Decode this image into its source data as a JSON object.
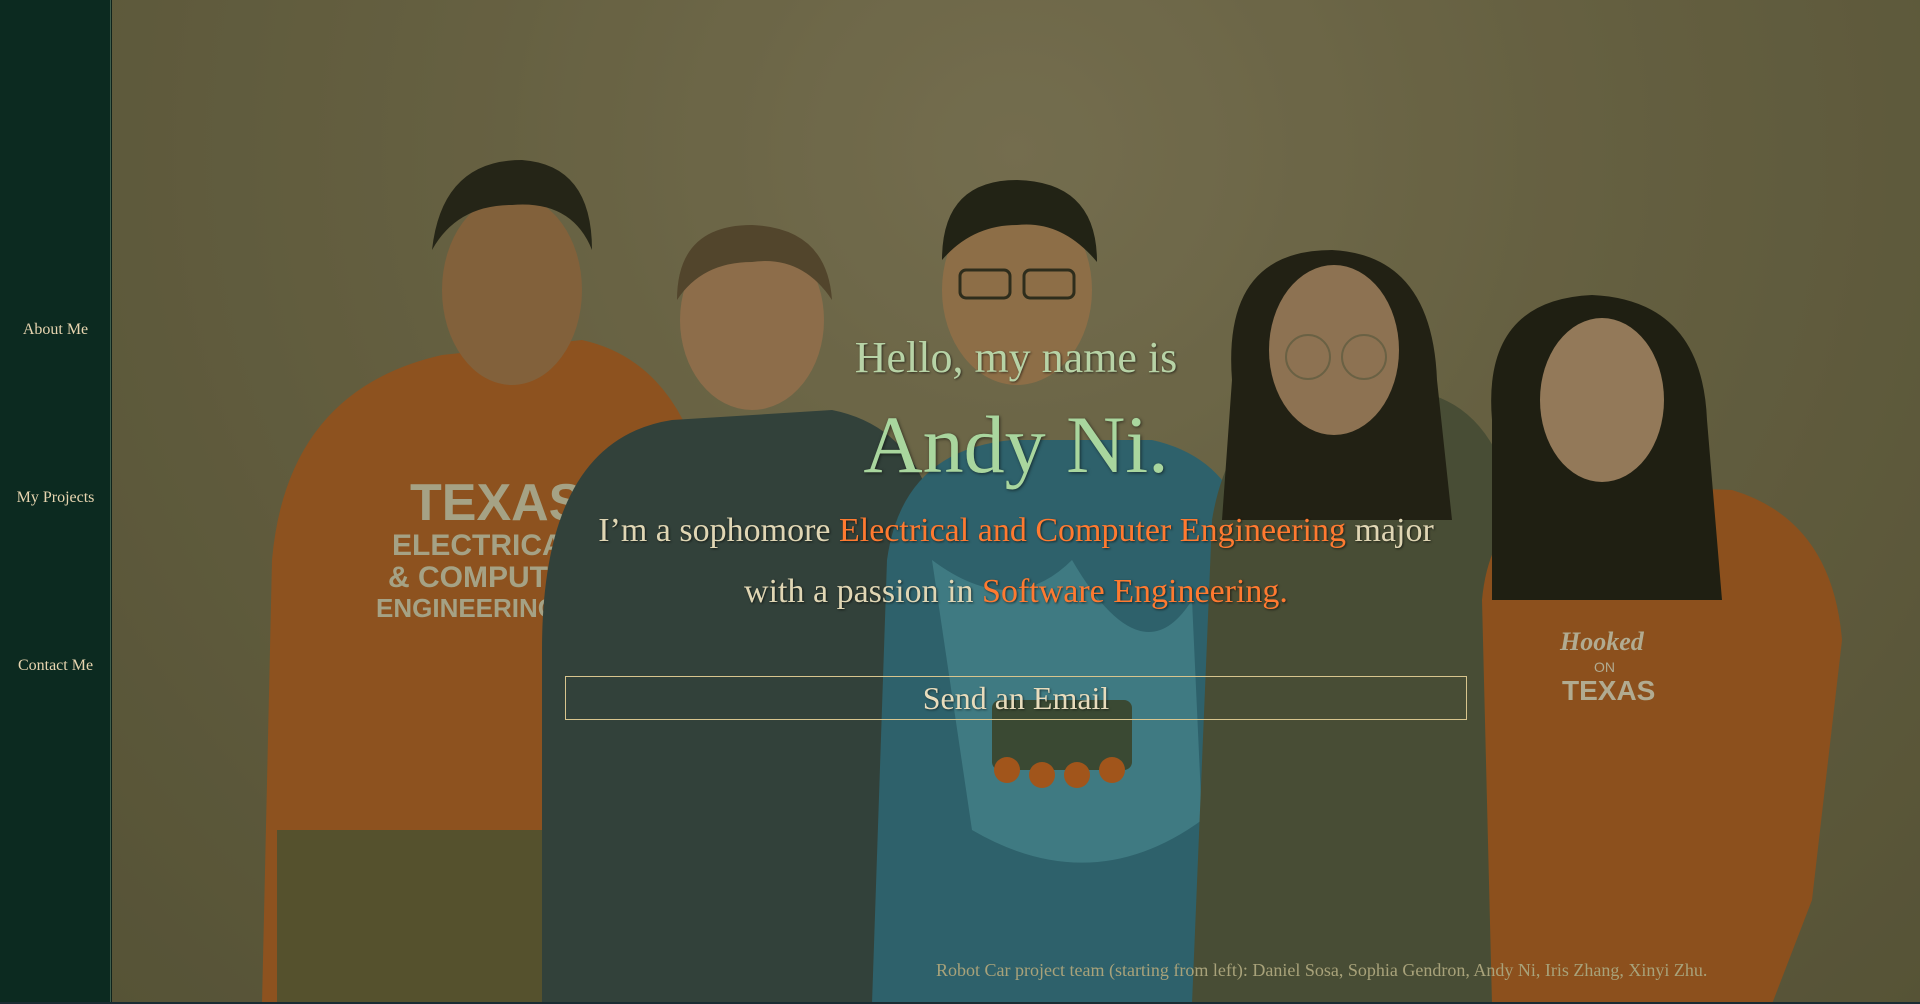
{
  "nav": {
    "items": [
      {
        "label": "About Me"
      },
      {
        "label": "My Projects"
      },
      {
        "label": "Contact Me"
      }
    ]
  },
  "hero": {
    "greeting": "Hello, my name is",
    "name": "Andy Ni.",
    "intro_prefix": "I’m a sophomore ",
    "intro_major": "Electrical and Computer Engineering",
    "intro_suffix": " major",
    "passion_prefix": "with a passion in ",
    "passion_field": "Software Engineering.",
    "email_button": "Send an Email",
    "caption": "Robot Car project team (starting from left): Daniel Sosa, Sophia Gendron, Andy Ni, Iris Zhang, Xinyi Zhu.",
    "shirt_text_1": "TEXAS",
    "shirt_text_2": "ELECTRICAL",
    "shirt_text_3": "& COMPUTER",
    "shirt_text_4": "ENGINEERING",
    "shirt_text_5": "Hooked",
    "shirt_text_6": "ON",
    "shirt_text_7": "TEXAS"
  },
  "colors": {
    "sidebar_bg": "#0c2a20",
    "nav_text": "#e8d5b0",
    "name_green": "#a9d69e",
    "accent_orange": "#ff7a30",
    "button_border": "#d8c58e"
  }
}
